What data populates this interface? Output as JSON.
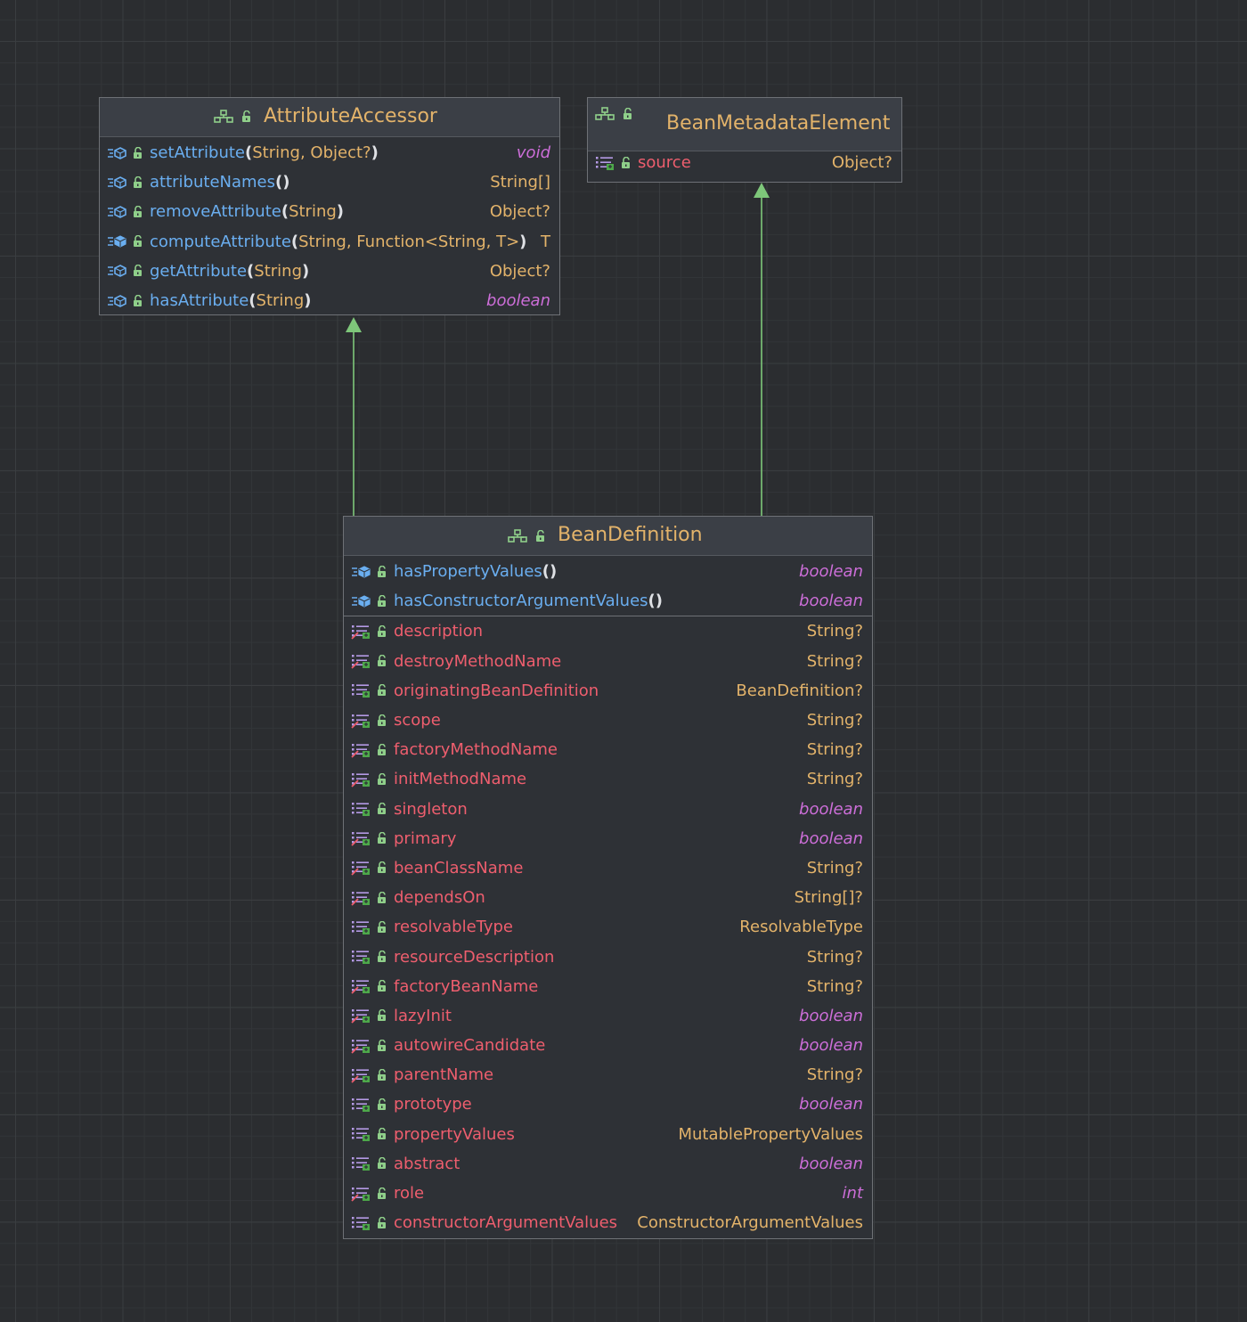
{
  "attribute_accessor": {
    "title": "AttributeAccessor",
    "methods": [
      {
        "name": "setAttribute",
        "args": "String, Object?",
        "type": "void",
        "prim": true,
        "icon": "abstract"
      },
      {
        "name": "attributeNames",
        "args": "",
        "type": "String[]",
        "prim": false,
        "icon": "abstract"
      },
      {
        "name": "removeAttribute",
        "args": "String",
        "type": "Object?",
        "prim": false,
        "icon": "abstract"
      },
      {
        "name": "computeAttribute",
        "args": "String, Function<String, T>",
        "type": "T",
        "prim": false,
        "icon": "default"
      },
      {
        "name": "getAttribute",
        "args": "String",
        "type": "Object?",
        "prim": false,
        "icon": "abstract"
      },
      {
        "name": "hasAttribute",
        "args": "String",
        "type": "boolean",
        "prim": true,
        "icon": "abstract"
      }
    ]
  },
  "bean_metadata_element": {
    "title": "BeanMetadataElement",
    "fields": [
      {
        "name": "source",
        "type": "Object?",
        "prim": false,
        "icon": "property-readonly"
      }
    ]
  },
  "bean_definition": {
    "title": "BeanDefinition",
    "methods": [
      {
        "name": "hasPropertyValues",
        "args": "",
        "type": "boolean",
        "prim": true,
        "icon": "default"
      },
      {
        "name": "hasConstructorArgumentValues",
        "args": "",
        "type": "boolean",
        "prim": true,
        "icon": "default"
      }
    ],
    "fields": [
      {
        "name": "description",
        "type": "String?",
        "prim": false,
        "icon": "property-rw"
      },
      {
        "name": "destroyMethodName",
        "type": "String?",
        "prim": false,
        "icon": "property-rw"
      },
      {
        "name": "originatingBeanDefinition",
        "type": "BeanDefinition?",
        "prim": false,
        "icon": "property-readonly"
      },
      {
        "name": "scope",
        "type": "String?",
        "prim": false,
        "icon": "property-rw"
      },
      {
        "name": "factoryMethodName",
        "type": "String?",
        "prim": false,
        "icon": "property-rw"
      },
      {
        "name": "initMethodName",
        "type": "String?",
        "prim": false,
        "icon": "property-rw"
      },
      {
        "name": "singleton",
        "type": "boolean",
        "prim": true,
        "icon": "property-readonly"
      },
      {
        "name": "primary",
        "type": "boolean",
        "prim": true,
        "icon": "property-rw"
      },
      {
        "name": "beanClassName",
        "type": "String?",
        "prim": false,
        "icon": "property-rw"
      },
      {
        "name": "dependsOn",
        "type": "String[]?",
        "prim": false,
        "icon": "property-rw"
      },
      {
        "name": "resolvableType",
        "type": "ResolvableType",
        "prim": false,
        "icon": "property-readonly"
      },
      {
        "name": "resourceDescription",
        "type": "String?",
        "prim": false,
        "icon": "property-readonly"
      },
      {
        "name": "factoryBeanName",
        "type": "String?",
        "prim": false,
        "icon": "property-rw"
      },
      {
        "name": "lazyInit",
        "type": "boolean",
        "prim": true,
        "icon": "property-rw"
      },
      {
        "name": "autowireCandidate",
        "type": "boolean",
        "prim": true,
        "icon": "property-rw"
      },
      {
        "name": "parentName",
        "type": "String?",
        "prim": false,
        "icon": "property-rw"
      },
      {
        "name": "prototype",
        "type": "boolean",
        "prim": true,
        "icon": "property-readonly"
      },
      {
        "name": "propertyValues",
        "type": "MutablePropertyValues",
        "prim": false,
        "icon": "property-readonly"
      },
      {
        "name": "abstract",
        "type": "boolean",
        "prim": true,
        "icon": "property-readonly"
      },
      {
        "name": "role",
        "type": "int",
        "prim": true,
        "icon": "property-rw"
      },
      {
        "name": "constructorArgumentValues",
        "type": "ConstructorArgumentValues",
        "prim": false,
        "icon": "property-readonly"
      }
    ]
  },
  "colors": {
    "background": "#2b2d30",
    "edge": "#7ec77a",
    "type_name": "#e3b36a",
    "method_name": "#6aaef0",
    "field_name": "#ee5e6e",
    "primitive": "#cc6ed8"
  }
}
